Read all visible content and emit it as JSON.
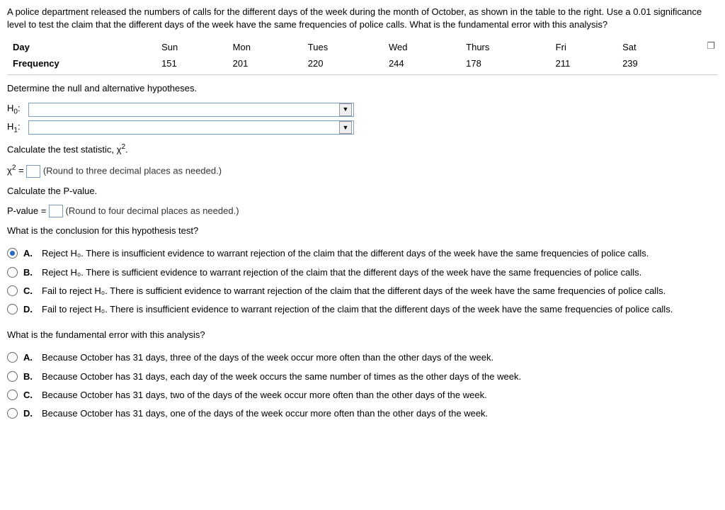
{
  "question": "A police department released the numbers of calls for the different days of the week during the month of October, as shown in the table to the right. Use a 0.01 significance level to test the claim that the different days of the week have the same frequencies of police calls. What is the fundamental error with this analysis?",
  "table": {
    "row1": [
      "Day",
      "Sun",
      "Mon",
      "Tues",
      "Wed",
      "Thurs",
      "Fri",
      "Sat"
    ],
    "row2": [
      "Frequency",
      "151",
      "201",
      "220",
      "244",
      "178",
      "211",
      "239"
    ]
  },
  "chart_data": {
    "type": "table",
    "categories": [
      "Sun",
      "Mon",
      "Tues",
      "Wed",
      "Thurs",
      "Fri",
      "Sat"
    ],
    "values": [
      151,
      201,
      220,
      244,
      178,
      211,
      239
    ],
    "title": "Police call frequency by day of week (October)"
  },
  "sections": {
    "hypotheses_prompt": "Determine the null and alternative hypotheses.",
    "h0_label": "H₀:",
    "h1_label": "H₁:",
    "chi_prompt": "Calculate the test statistic, χ².",
    "chi_label": "χ² =",
    "chi_hint": "(Round to three decimal places as needed.)",
    "pval_prompt": "Calculate the P-value.",
    "pval_label": "P-value =",
    "pval_hint": "(Round to four decimal places as needed.)",
    "conclusion_prompt": "What is the conclusion for this hypothesis test?",
    "error_prompt": "What is the fundamental error with this analysis?"
  },
  "conclusion_options": {
    "A": "Reject H₀. There is insufficient evidence to warrant rejection of the claim that the different days of the week have the same frequencies of police calls.",
    "B": "Reject H₀. There is sufficient evidence to warrant rejection of the claim that the different days of the week have the same frequencies of police calls.",
    "C": "Fail to reject H₀. There is sufficient evidence to warrant rejection of the claim that the different days of the week have the same frequencies of police calls.",
    "D": "Fail to reject H₀. There is insufficient evidence to warrant rejection of the claim that the different days of the week have the same frequencies of police calls."
  },
  "error_options": {
    "A": "Because October has 31 days, three of the days of the week occur more often than the other days of the week.",
    "B": "Because October has 31 days, each day of the week occurs the same number of times as the other days of the week.",
    "C": "Because October has 31 days, two of the days of the week occur more often than the other days of the week.",
    "D": "Because October has 31 days, one of the days of the week occur more often than the other days of the week."
  },
  "letters": {
    "A": "A.",
    "B": "B.",
    "C": "C.",
    "D": "D."
  }
}
